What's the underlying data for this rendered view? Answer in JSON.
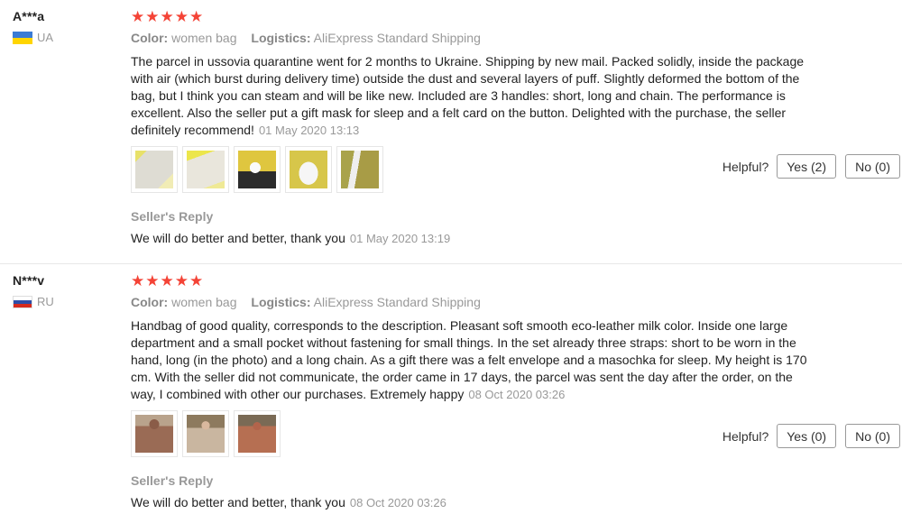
{
  "reviews": [
    {
      "username": "A***a",
      "country": "UA",
      "stars": "★★★★★",
      "color_key": "Color:",
      "color_value": "women bag",
      "logistics_key": "Logistics:",
      "logistics_value": "AliExpress Standard Shipping",
      "text": "The parcel in ussovia quarantine went for 2 months to Ukraine. Shipping by new mail. Packed solidly, inside the package with air (which burst during delivery time) outside the dust and several layers of puff. Slightly deformed the bottom of the bag, but I think you can steam and will be like new. Included are 3 handles: short, long and chain. The performance is excellent. Also the seller put a gift mask for sleep and a felt card on the button. Delighted with the purchase, the seller definitely recommend!",
      "date": "01 May 2020 13:13",
      "helpful_label": "Helpful?",
      "yes_label": "Yes (2)",
      "no_label": "No (0)",
      "reply_label": "Seller's Reply",
      "reply_text": "We will do better and better, thank you",
      "reply_date": "01 May 2020 13:19"
    },
    {
      "username": "N***v",
      "country": "RU",
      "stars": "★★★★★",
      "color_key": "Color:",
      "color_value": "women bag",
      "logistics_key": "Logistics:",
      "logistics_value": "AliExpress Standard Shipping",
      "text": "Handbag of good quality, corresponds to the description. Pleasant soft smooth eco-leather milk color. Inside one large department and a small pocket without fastening for small things. In the set already three straps: short to be worn in the hand, long (in the photo) and a long chain. As a gift there was a felt envelope and a masochka for sleep. My height is 170 cm. With the seller did not communicate, the order came in 17 days, the parcel was sent the day after the order, on the way, I combined with other our purchases. Extremely happy",
      "date": "08 Oct 2020 03:26",
      "helpful_label": "Helpful?",
      "yes_label": "Yes (0)",
      "no_label": "No (0)",
      "reply_label": "Seller's Reply",
      "reply_text": "We will do better and better, thank you",
      "reply_date": "08 Oct 2020 03:26"
    }
  ],
  "colors": {
    "star": "#f44336",
    "muted": "#999999",
    "border": "#e8e8e8"
  }
}
